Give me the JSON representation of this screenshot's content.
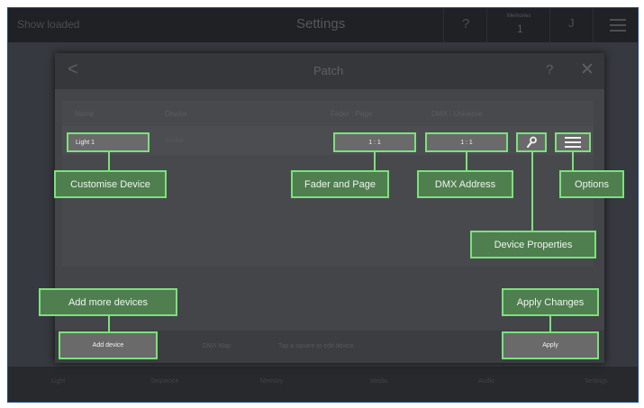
{
  "topbar": {
    "status": "Show loaded",
    "title": "Settings",
    "help": "?",
    "memories_label": "Memories",
    "memories_value": "1",
    "user_initial": "J"
  },
  "modal": {
    "back": "<",
    "title": "Patch",
    "help": "?",
    "close": "✕",
    "columns": [
      "Name",
      "Device",
      "Fader : Page",
      "DMX : Universe"
    ],
    "row": {
      "name": "Light 1",
      "device": "Strobe",
      "fader_page": "1 : 1",
      "dmx_universe": "1 : 1"
    },
    "bottom": {
      "add_device": "Add device",
      "dmx_map": "DMX Map",
      "hint": "Tap a square to edit device.",
      "apply": "Apply"
    }
  },
  "callouts": {
    "customise": "Customise Device",
    "fader": "Fader and Page",
    "dmx": "DMX Address",
    "options": "Options",
    "properties": "Device Properties",
    "add_more": "Add more devices",
    "apply_changes": "Apply Changes"
  },
  "bottombar": {
    "items": [
      "Light",
      "Sequence",
      "Memory",
      "Media",
      "Audio",
      "Settings"
    ]
  },
  "colors": {
    "callout_border": "#7be27b",
    "callout_fill": "#4f7c4f",
    "frame_border": "#1d4a8a"
  }
}
